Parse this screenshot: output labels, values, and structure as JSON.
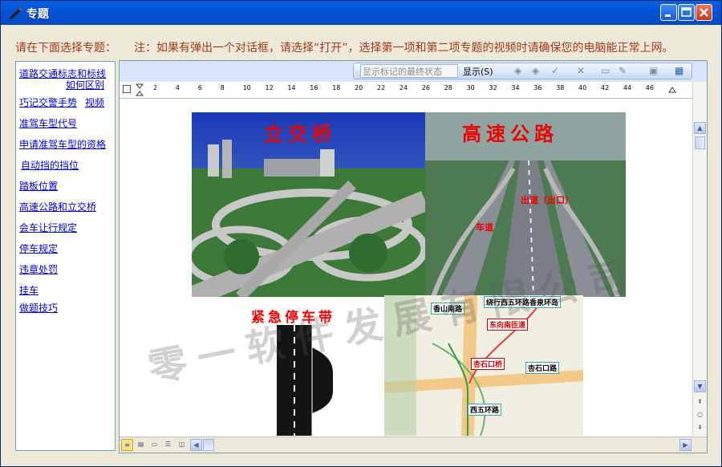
{
  "window": {
    "title": "专题"
  },
  "hints": {
    "left": "请在下面选择专题：",
    "right": "注：如果有弹出一个对话框，请选择“打开”，选择第一项和第二项专题的视频时请确保您的电脑能正常上网。"
  },
  "topics": [
    {
      "line1": "道路交通标志和标线",
      "line2": "如何区别"
    },
    {
      "label": "巧记交警手势",
      "extra": "视频"
    },
    {
      "label": "准驾车型代号"
    },
    {
      "label": "申请准驾车型的资格"
    },
    {
      "label": "自动挡的挡位"
    },
    {
      "label": "踏板位置"
    },
    {
      "label": "高速公路和立交桥"
    },
    {
      "label": "会车让行规定"
    },
    {
      "label": "停车规定"
    },
    {
      "label": "违章处罚"
    },
    {
      "label": "挂车"
    },
    {
      "label": "做题技巧"
    }
  ],
  "toolbar": {
    "markup_state": "显示标记的最终状态",
    "show_label": "显示(S)"
  },
  "ruler": {
    "numbers": [
      "2",
      "4",
      "6",
      "8",
      "10",
      "12",
      "14",
      "16",
      "18",
      "20",
      "22",
      "24",
      "26",
      "28",
      "30",
      "32",
      "34",
      "36",
      "38",
      "40",
      "42",
      "44",
      "46"
    ]
  },
  "images": {
    "interchange_title": "立交桥",
    "highway_title": "高速公路",
    "highway_label_exit": "出道（出口）",
    "highway_label_lane": "车道",
    "emergency_title": "紧急停车带",
    "map_labels": [
      "香山南路",
      "绕行西五环路香泉环岛",
      "东向南匝道",
      "杏石口桥",
      "杏石口路",
      "西五环路"
    ]
  },
  "watermark": "零一软件发展有限公司",
  "colors": {
    "title_bar": "#0453d8",
    "hint_text": "#a33a1e",
    "link": "#0000cc",
    "red_title": "#e00000"
  }
}
